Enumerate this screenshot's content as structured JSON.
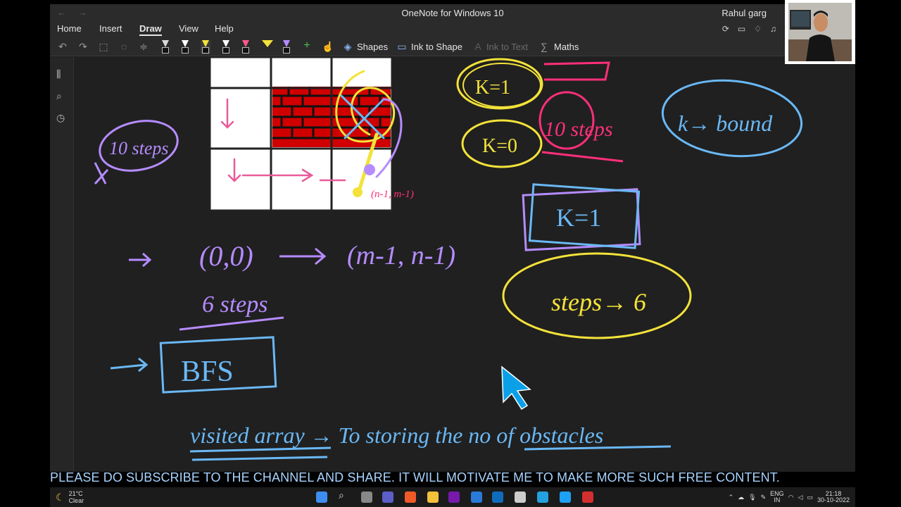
{
  "window": {
    "title": "OneNote for Windows 10",
    "user": "Rahul garg",
    "nav_back": "←",
    "nav_forward": "→"
  },
  "menu": {
    "items": [
      "Home",
      "Insert",
      "Draw",
      "View",
      "Help"
    ],
    "active": "Draw"
  },
  "ribbon": {
    "shapes_label": "Shapes",
    "ink_to_shape_label": "Ink to Shape",
    "ink_to_text_label": "Ink to Text",
    "maths_label": "Maths",
    "pen_colors": [
      "#d9d9d9",
      "#ffffff",
      "#f3e23a",
      "#ffffff",
      "#ff5a8c",
      "#f3e23a",
      "#b58cff"
    ]
  },
  "ink": {
    "grid_label": "(n-1, m-1)",
    "left_note": "10 steps",
    "arrow_coords_a": "(0,0)",
    "arrow_coords_b": "(m-1, n-1)",
    "six_steps": "6 steps",
    "bfs": "BFS",
    "k1_top": "K=1",
    "k0": "K=0",
    "ten_steps": "10 steps",
    "k_bound": "k→ bound",
    "k1_box": "K=1",
    "steps_6": "steps→ 6",
    "visited_line": "visited array → To storing the no of obstacles"
  },
  "subtitle": "PLEASE DO SUBSCRIBE TO THE CHANNEL AND SHARE. IT WILL MOTIVATE ME TO MAKE MORE SUCH FREE CONTENT.",
  "taskbar": {
    "temperature": "21°C",
    "condition": "Clear",
    "lang_top": "ENG",
    "lang_bottom": "IN",
    "time": "21:18",
    "date": "30-10-2022"
  },
  "colors": {
    "ink_pink": "#e85a9a",
    "ink_purple": "#b58cff",
    "ink_yellow": "#f3e23a",
    "ink_blue": "#6ab8f5",
    "ink_magenta": "#ff2f7a",
    "brick_red": "#e00000"
  }
}
